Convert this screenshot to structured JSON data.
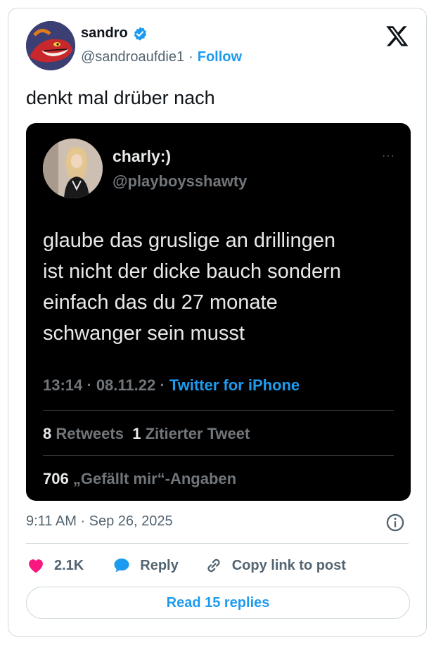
{
  "tweet": {
    "author_name": "sandro",
    "author_handle": "@sandroaufdie1",
    "separator": "·",
    "follow_label": "Follow",
    "text": "denkt mal drüber nach",
    "timestamp": "9:11 AM · Sep 26, 2025"
  },
  "embedded": {
    "name": "charly:)",
    "handle": "@playboysshawty",
    "more": "···",
    "lines": [
      "glaube das gruslige an drillingen",
      "ist nicht der dicke bauch sondern",
      "einfach das du 27 monate",
      "schwanger sein musst"
    ],
    "meta_time": "13:14 · 08.11.22 · ",
    "meta_source": "Twitter for iPhone",
    "retweets_count": "8",
    "retweets_label": "Retweets",
    "quotes_count": "1",
    "quotes_label": "Zitierter Tweet",
    "likes_count": "706",
    "likes_label": "„Gefällt mir“-Angaben"
  },
  "actions": {
    "like_count": "2.1K",
    "reply_label": "Reply",
    "copy_label": "Copy link to post",
    "read_replies": "Read 15 replies"
  },
  "colors": {
    "accent": "#1d9bf0",
    "like": "#f91880",
    "text": "#0f1419",
    "muted": "#536471"
  },
  "icons": {
    "verified": "verified-badge-icon",
    "logo": "x-logo-icon",
    "info": "info-icon",
    "like": "heart-icon",
    "reply": "speech-bubble-icon",
    "copy": "link-icon"
  }
}
